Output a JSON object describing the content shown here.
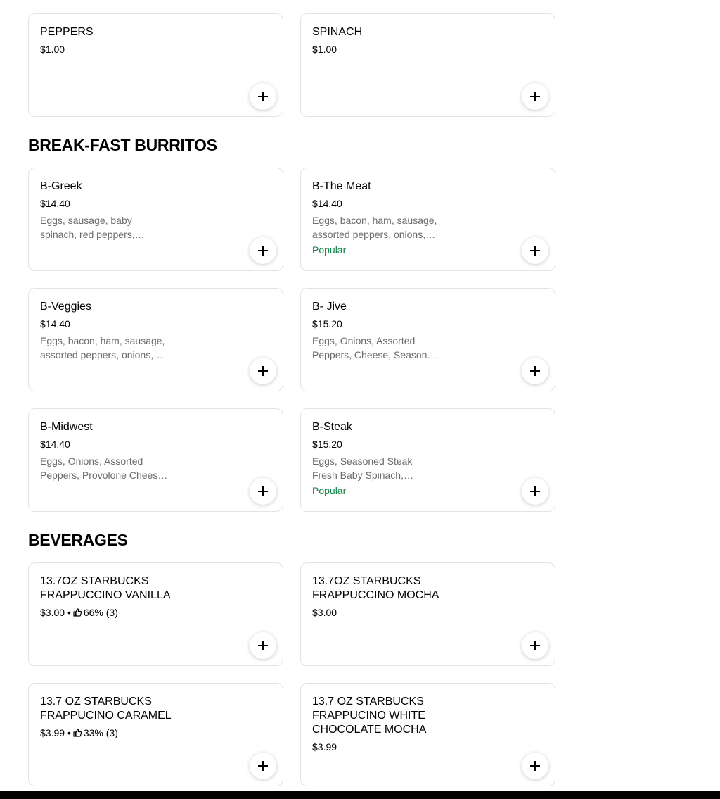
{
  "top_items": [
    {
      "name": "PEPPERS",
      "price": "$1.00"
    },
    {
      "name": "SPINACH",
      "price": "$1.00"
    }
  ],
  "sections": [
    {
      "title": "BREAK-FAST BURRITOS",
      "items": [
        {
          "name": "B-Greek",
          "price": "$14.40",
          "description": "Eggs, sausage, baby spinach, red peppers, onions, feta cheese"
        },
        {
          "name": "B-The Meat",
          "price": "$14.40",
          "description": "Eggs, bacon, ham, sausage, assorted peppers, onions, cheese",
          "badge": "Popular"
        },
        {
          "name": "B-Veggies",
          "price": "$14.40",
          "description": "Eggs, bacon, ham, sausage, assorted peppers, onions, cheese"
        },
        {
          "name": "B- Jive",
          "price": "$15.20",
          "description": "Eggs, Onions, Assorted Peppers, Cheese, Seasoned Potatoes"
        },
        {
          "name": "B-Midwest",
          "price": "$14.40",
          "description": "Eggs, Onions, Assorted Peppers, Provolone Cheese, Potatoes"
        },
        {
          "name": "B-Steak",
          "price": "$15.20",
          "description": "Eggs, Seasoned Steak Fresh Baby Spinach, Assorted Peppers",
          "badge": "Popular"
        }
      ]
    },
    {
      "title": "BEVERAGES",
      "items": [
        {
          "name": "13.7OZ STARBUCKS FRAPPUCCINO VANILLA",
          "price": "$3.00",
          "rating_sep": "•",
          "rating": "66% (3)"
        },
        {
          "name": "13.7OZ STARBUCKS FRAPPUCCINO MOCHA",
          "price": "$3.00"
        },
        {
          "name": "13.7 OZ STARBUCKS FRAPPUCINO CARAMEL",
          "price": "$3.99",
          "rating_sep": "•",
          "rating": "33% (3)"
        },
        {
          "name": "13.7 OZ STARBUCKS FRAPPUCINO WHITE CHOCOLATE MOCHA",
          "price": "$3.99"
        }
      ]
    }
  ],
  "icons": {
    "add": "plus-icon",
    "rating": "thumbs-up-icon"
  },
  "colors": {
    "popular_badge": "#0e8345",
    "description": "#6b6b6b",
    "border": "#e3e3e3"
  }
}
